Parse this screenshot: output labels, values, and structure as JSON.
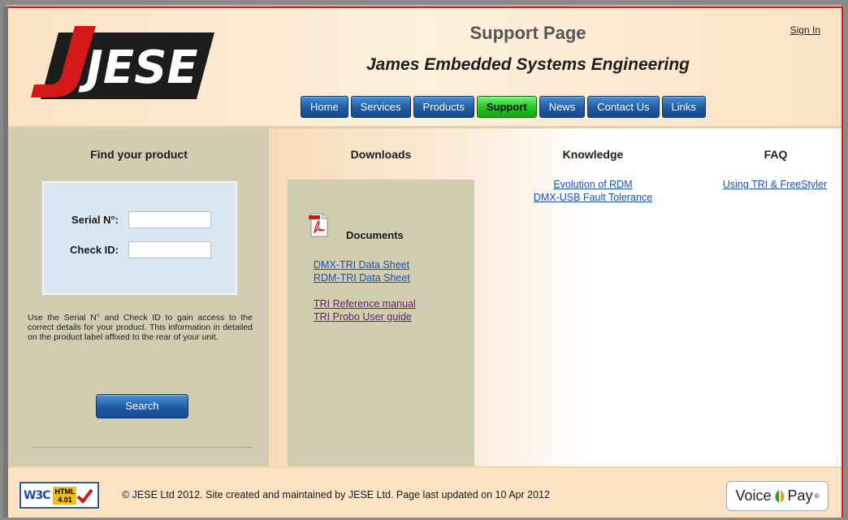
{
  "header": {
    "logo_text": "JESE",
    "title": "Support Page",
    "subtitle": "James Embedded Systems Engineering",
    "sign_in": "Sign In"
  },
  "nav": {
    "items": [
      {
        "label": "Home",
        "active": false
      },
      {
        "label": "Services",
        "active": false
      },
      {
        "label": "Products",
        "active": false
      },
      {
        "label": "Support",
        "active": true
      },
      {
        "label": "News",
        "active": false
      },
      {
        "label": "Contact Us",
        "active": false
      },
      {
        "label": "Links",
        "active": false
      }
    ]
  },
  "find": {
    "title": "Find your product",
    "serial_label": "Serial N°:",
    "serial_value": "",
    "check_label": "Check ID:",
    "check_value": "",
    "help": "Use the Serial N° and Check ID to gain access to the correct details for your product. This information in detailed on the product label affixed to the rear of your unit.",
    "search_label": "Search"
  },
  "downloads": {
    "title": "Downloads",
    "documents_heading": "Documents",
    "links": [
      {
        "label": "DMX-TRI Data Sheet",
        "visited": false
      },
      {
        "label": "RDM-TRI Data Sheet",
        "visited": false
      },
      {
        "label": "TRI Reference manual",
        "visited": true
      },
      {
        "label": "TRI Probo User guide",
        "visited": true
      }
    ]
  },
  "knowledge": {
    "title": "Knowledge",
    "links": [
      "Evolution of RDM",
      "DMX-USB Fault Tolerance"
    ]
  },
  "faq": {
    "title": "FAQ",
    "links": [
      "Using TRI & FreeStyler"
    ]
  },
  "footer": {
    "w3c_text": "W3C",
    "w3c_html": "HTML",
    "w3c_version": "4.01",
    "copyright": "© JESE Ltd 2012. Site created and maintained by JESE Ltd. Page last updated on 10 Apr 2012",
    "voicepay_left": "Voice",
    "voicepay_right": "Pay",
    "voicepay_reg": "®"
  },
  "colors": {
    "accent_red": "#e01818",
    "nav_blue": "#1f5aa3",
    "nav_active_green": "#24c224",
    "panel_khaki": "#d0cdb1",
    "link_blue": "#1a4fc2",
    "link_visited": "#6a1a7a"
  }
}
